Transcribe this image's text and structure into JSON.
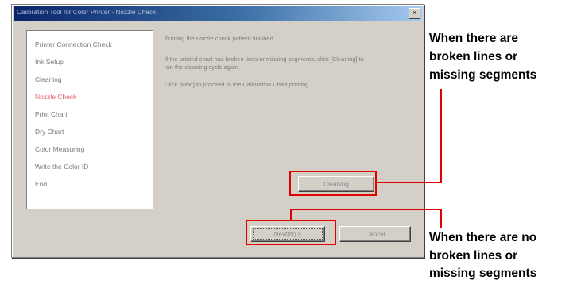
{
  "window": {
    "title": "Calibration Tool for Color Printer - Nozzle Check",
    "close_glyph": "×"
  },
  "steps": [
    {
      "label": "Printer Connection Check",
      "active": false
    },
    {
      "label": "Ink Setup",
      "active": false
    },
    {
      "label": "Cleaning",
      "active": false
    },
    {
      "label": "Nozzle Check",
      "active": true
    },
    {
      "label": "Print Chart",
      "active": false
    },
    {
      "label": "Dry Chart",
      "active": false
    },
    {
      "label": "Color Measuring",
      "active": false
    },
    {
      "label": "Write the Color ID",
      "active": false
    },
    {
      "label": "End",
      "active": false
    }
  ],
  "message": {
    "line1": "Printing the nozzle check pattern finished.",
    "line2a": "If the printed chart has broken lines or missing segments, click [Cleaning] to",
    "line2b": "run the cleaning cycle again.",
    "line3": "Click [Next] to proceed to the Calibration Chart printing."
  },
  "buttons": {
    "cleaning": "Cleaning",
    "next": "Next(N) >",
    "cancel": "Cancel"
  },
  "annotations": {
    "broken": [
      "When there are",
      "broken lines or",
      "missing segments"
    ],
    "no_broken": [
      "When there are no",
      "broken lines or",
      "missing segments"
    ]
  },
  "colors": {
    "annotation_red": "#e00000",
    "active_step": "#e06070",
    "titlebar": "#0a246a"
  }
}
